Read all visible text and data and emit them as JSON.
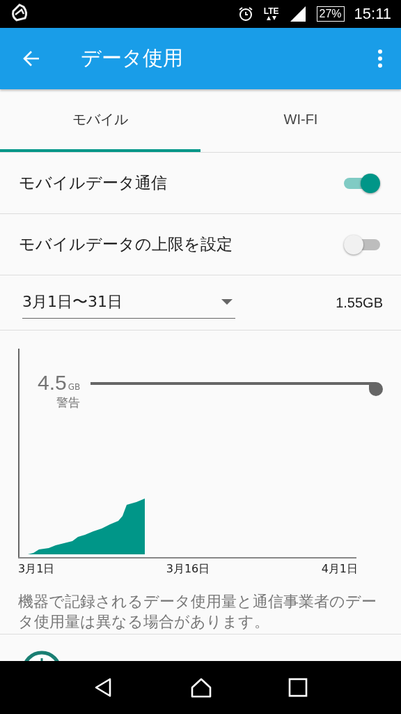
{
  "status_bar": {
    "network": "LTE",
    "battery": "27%",
    "time": "15:11"
  },
  "app_bar": {
    "title": "データ使用"
  },
  "tabs": [
    {
      "label": "モバイル",
      "selected": true
    },
    {
      "label": "WI-FI",
      "selected": false
    }
  ],
  "switches": [
    {
      "label": "モバイルデータ通信",
      "on": true
    },
    {
      "label": "モバイルデータの上限を設定",
      "on": false
    }
  ],
  "cycle": {
    "value": "3月1日〜31日",
    "total": "1.55GB"
  },
  "chart": {
    "warning_value": "4.5",
    "warning_unit": "GB",
    "warning_label": "警告",
    "x_labels": [
      "3月1日",
      "3月16日",
      "4月1日"
    ]
  },
  "note": "機器で記録されるデータ使用量と通信事業者のデータ使用量は異なる場合があります。"
}
